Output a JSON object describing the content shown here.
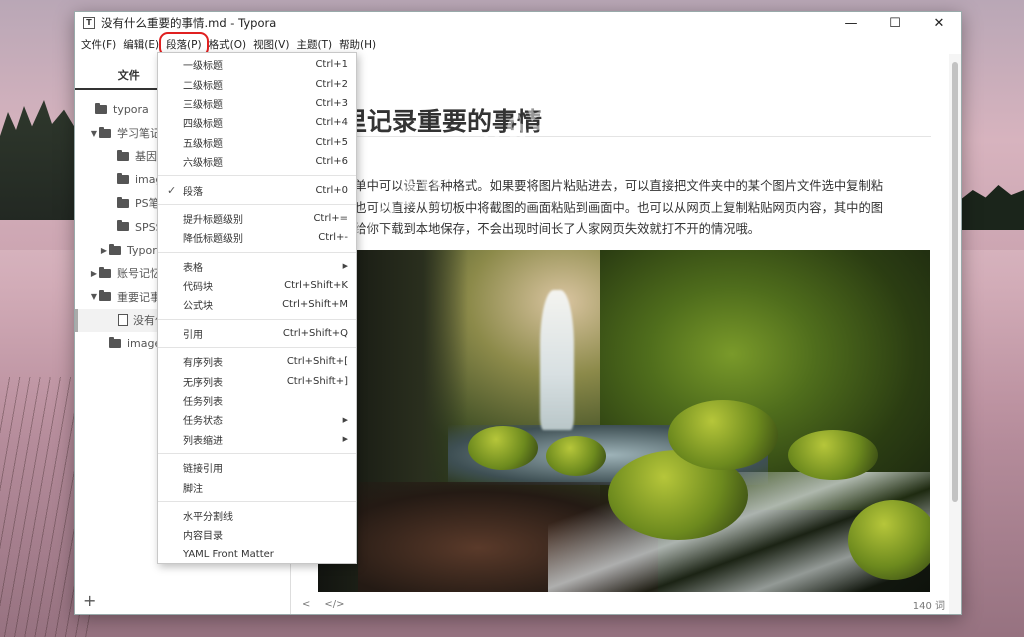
{
  "window": {
    "title": "没有什么重要的事情.md - Typora",
    "app_icon": "T",
    "controls": {
      "minimize": "—",
      "maximize": "☐",
      "close": "✕"
    }
  },
  "menubar": [
    "文件(F)",
    "编辑(E)",
    "段落(P)",
    "格式(O)",
    "视图(V)",
    "主题(T)",
    "帮助(H)"
  ],
  "sidebar": {
    "tabs": [
      "文件",
      ""
    ],
    "tree": [
      {
        "label": "typora",
        "caret": "",
        "type": "folder"
      },
      {
        "label": "学习笔记",
        "caret": "▼",
        "type": "folder"
      },
      {
        "label": "基因编辑",
        "caret": "",
        "type": "folder"
      },
      {
        "label": "images",
        "caret": "",
        "type": "folder"
      },
      {
        "label": "PS笔记",
        "caret": "",
        "type": "folder"
      },
      {
        "label": "SPSS笔记",
        "caret": "",
        "type": "folder"
      },
      {
        "label": "Typora笔记",
        "caret": "▶",
        "type": "folder"
      },
      {
        "label": "账号记忆",
        "caret": "▶",
        "type": "folder"
      },
      {
        "label": "重要记事",
        "caret": "▼",
        "type": "folder"
      },
      {
        "label": "没有什么重要的事情",
        "caret": "",
        "type": "file"
      },
      {
        "label": "images",
        "caret": "",
        "type": "folder"
      }
    ],
    "footer_icon": "+"
  },
  "document": {
    "heading": "里记录重要的事情",
    "paragraph": [
      "菜单中可以设置各种格式。如果要将图片粘贴进去，可以直接把文件夹中的某个图片文件选中复制粘",
      "，也可以直接从剪切板中将截图的画面粘贴到画面中。也可以从网页上复制粘贴网页内容，其中的图",
      "动给你下载到本地保存，不会出现时间长了人家网页失效就打不开的情况哦。"
    ],
    "watermark": "www.admin365.cn"
  },
  "statusbar": {
    "left": [
      "<",
      "</>"
    ],
    "word_count": "140 词"
  },
  "paragraph_menu": {
    "groups": [
      [
        {
          "label": "一级标题",
          "shortcut": "Ctrl+1"
        },
        {
          "label": "二级标题",
          "shortcut": "Ctrl+2"
        },
        {
          "label": "三级标题",
          "shortcut": "Ctrl+3"
        },
        {
          "label": "四级标题",
          "shortcut": "Ctrl+4"
        },
        {
          "label": "五级标题",
          "shortcut": "Ctrl+5"
        },
        {
          "label": "六级标题",
          "shortcut": "Ctrl+6"
        }
      ],
      [
        {
          "label": "段落",
          "shortcut": "Ctrl+0",
          "checked": true
        }
      ],
      [
        {
          "label": "提升标题级别",
          "shortcut": "Ctrl+="
        },
        {
          "label": "降低标题级别",
          "shortcut": "Ctrl+-"
        }
      ],
      [
        {
          "label": "表格",
          "shortcut": "",
          "submenu": true
        },
        {
          "label": "代码块",
          "shortcut": "Ctrl+Shift+K"
        },
        {
          "label": "公式块",
          "shortcut": "Ctrl+Shift+M"
        }
      ],
      [
        {
          "label": "引用",
          "shortcut": "Ctrl+Shift+Q"
        }
      ],
      [
        {
          "label": "有序列表",
          "shortcut": "Ctrl+Shift+["
        },
        {
          "label": "无序列表",
          "shortcut": "Ctrl+Shift+]"
        },
        {
          "label": "任务列表",
          "shortcut": ""
        },
        {
          "label": "任务状态",
          "shortcut": "",
          "submenu": true
        },
        {
          "label": "列表缩进",
          "shortcut": "",
          "submenu": true
        }
      ],
      [
        {
          "label": "链接引用",
          "shortcut": ""
        },
        {
          "label": "脚注",
          "shortcut": ""
        }
      ],
      [
        {
          "label": "水平分割线",
          "shortcut": ""
        },
        {
          "label": "内容目录",
          "shortcut": ""
        },
        {
          "label": "YAML Front Matter",
          "shortcut": ""
        }
      ]
    ],
    "check_glyph": "✓",
    "submenu_glyph": "▶"
  }
}
